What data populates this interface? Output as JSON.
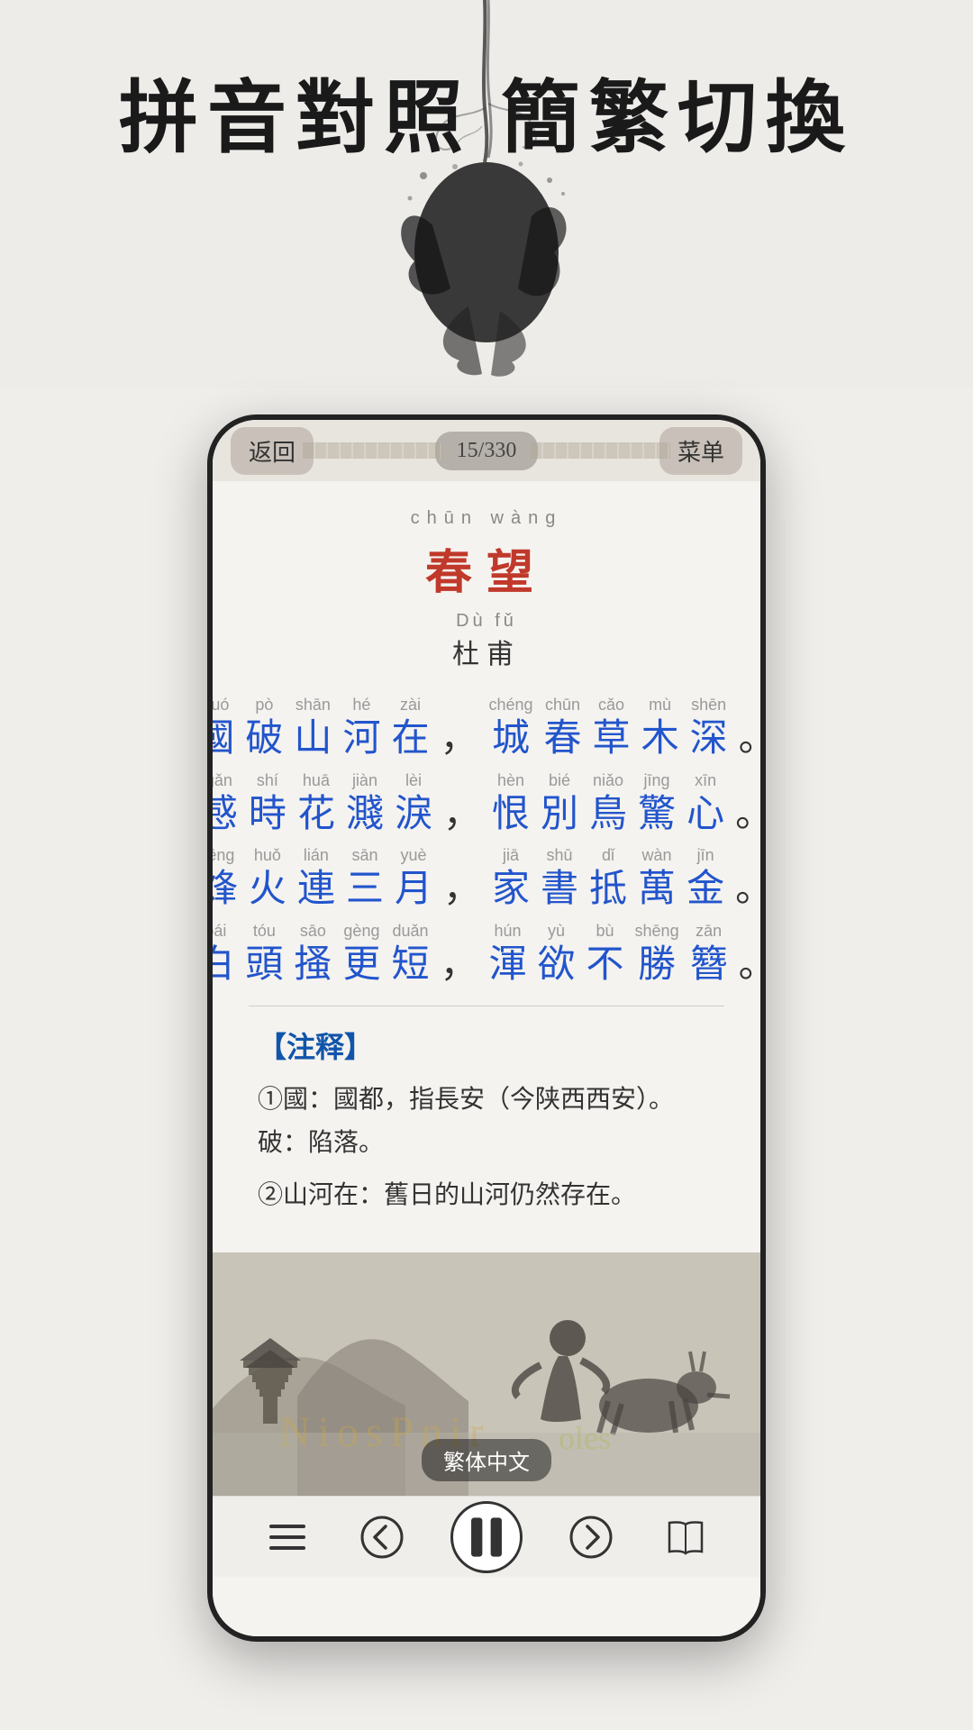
{
  "promo": {
    "title": "拼音對照  簡繁切換"
  },
  "topBar": {
    "backLabel": "返回",
    "counter": "15/330",
    "menuLabel": "菜单"
  },
  "poem": {
    "titlePinyin": "chūn wàng",
    "titleChinese": "春望",
    "authorPinyin": "Dù  fǔ",
    "authorChinese": "杜甫",
    "lines": [
      {
        "chars": [
          "國",
          "破",
          "山",
          "河",
          "在"
        ],
        "pinyins": [
          "guó",
          "pò",
          "shān",
          "hé",
          "zài"
        ],
        "punct": "，",
        "chars2": [
          "城",
          "春",
          "草",
          "木",
          "深"
        ],
        "pinyins2": [
          "chéng",
          "chūn",
          "cǎo",
          "mù",
          "shēn"
        ],
        "punct2": "。"
      },
      {
        "chars": [
          "感",
          "時",
          "花",
          "濺",
          "淚"
        ],
        "pinyins": [
          "gǎn",
          "shí",
          "huā",
          "jiàn",
          "lèi"
        ],
        "punct": "，",
        "chars2": [
          "恨",
          "別",
          "鳥",
          "驚",
          "心"
        ],
        "pinyins2": [
          "hèn",
          "bié",
          "niǎo",
          "jīng",
          "xīn"
        ],
        "punct2": "。"
      },
      {
        "chars": [
          "烽",
          "火",
          "連",
          "三",
          "月"
        ],
        "pinyins": [
          "fēng",
          "huǒ",
          "lián",
          "sān",
          "yuè"
        ],
        "punct": "，",
        "chars2": [
          "家",
          "書",
          "抵",
          "萬",
          "金"
        ],
        "pinyins2": [
          "jiā",
          "shū",
          "dǐ",
          "wàn",
          "jīn"
        ],
        "punct2": "。"
      },
      {
        "chars": [
          "白",
          "頭",
          "搔",
          "更",
          "短"
        ],
        "pinyins": [
          "bái",
          "tóu",
          "sāo",
          "gèng",
          "duǎn"
        ],
        "punct": "，",
        "chars2": [
          "渾",
          "欲",
          "不",
          "勝",
          "簪"
        ],
        "pinyins2": [
          "hún",
          "yù",
          "bù",
          "shēng",
          "zān"
        ],
        "punct2": "。"
      }
    ]
  },
  "notes": {
    "title": "【注释】",
    "items": [
      "①國：國都，指長安（今陕西西安）。破：陷落。",
      "②山河在：舊日的山河仍然存在。"
    ]
  },
  "imageSection": {
    "label": "繁体中文"
  },
  "bottomNav": {
    "menuIcon": "≡",
    "backIcon": "←",
    "playIcon": "⏸",
    "forwardIcon": "→",
    "bookIcon": "📖"
  }
}
